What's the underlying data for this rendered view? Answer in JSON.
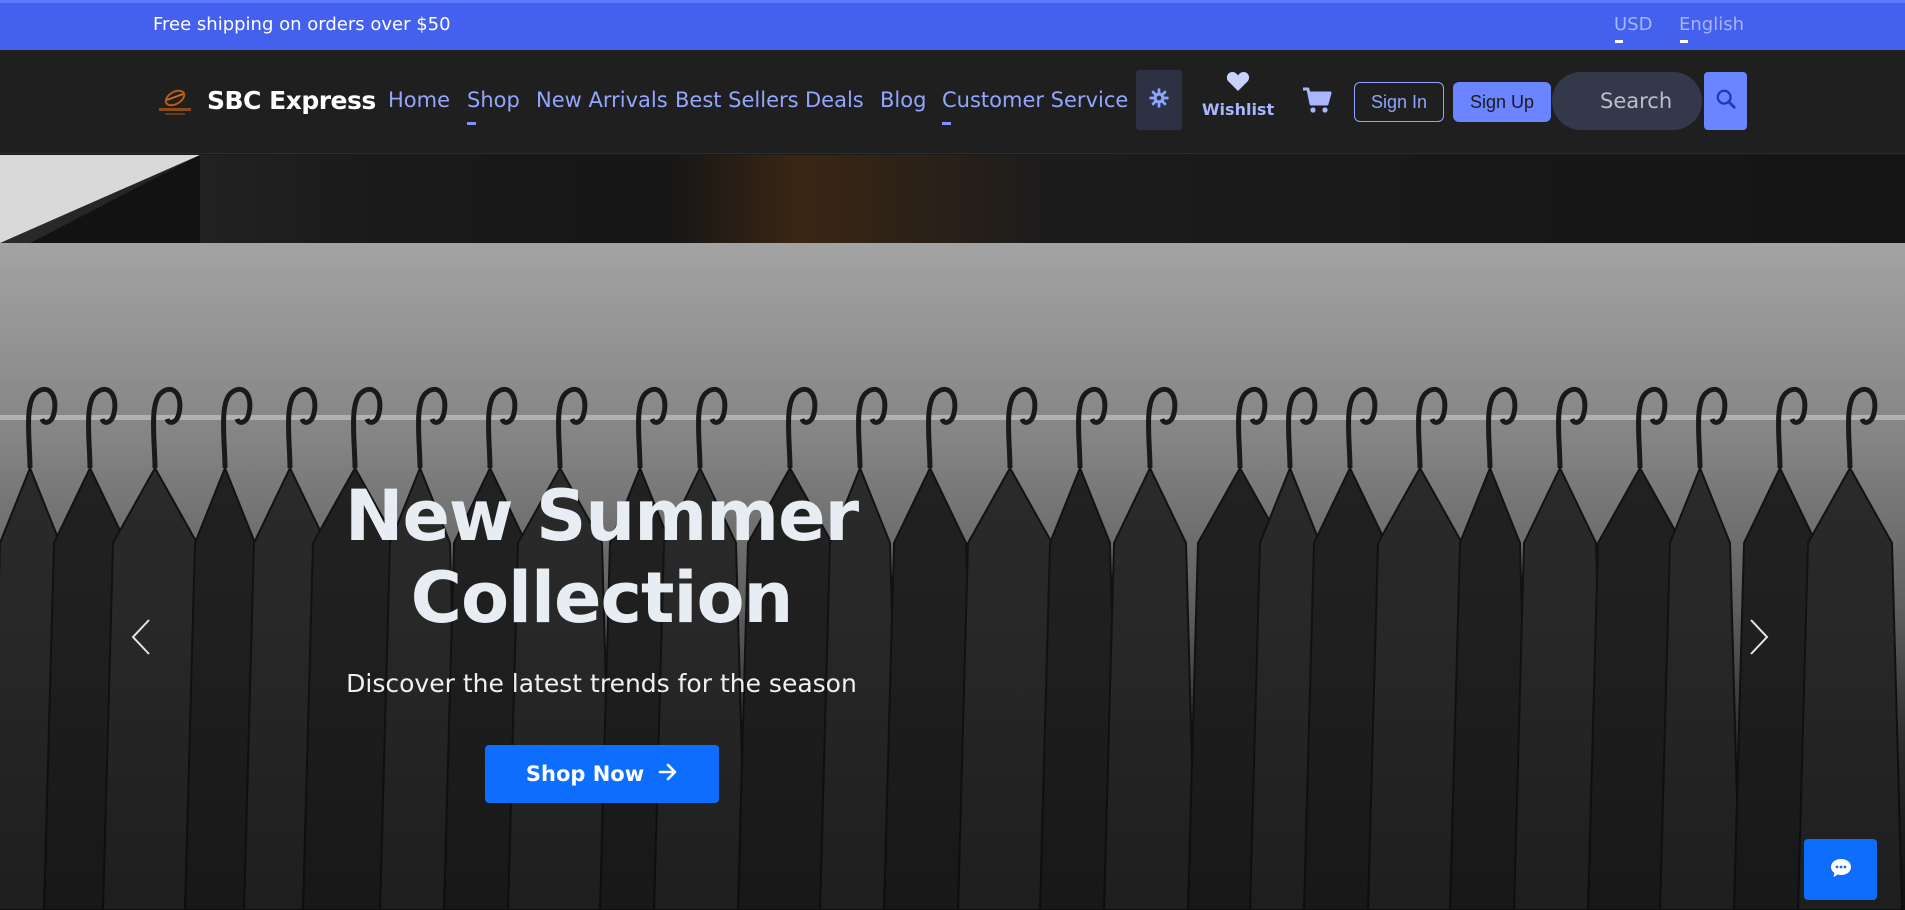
{
  "topbar": {
    "promo_text": "Free shipping on orders over $50",
    "currency": "USD",
    "language": "English"
  },
  "header": {
    "brand_name": "SBC Express",
    "nav": [
      {
        "label": "Home"
      },
      {
        "label": "Shop"
      },
      {
        "label": "New Arrivals"
      },
      {
        "label": "Best Sellers"
      },
      {
        "label": "Deals"
      },
      {
        "label": "Blog"
      },
      {
        "label": "Customer Service"
      }
    ],
    "wishlist_label": "Wishlist",
    "sign_in_label": "Sign In",
    "sign_up_label": "Sign Up",
    "search_placeholder": "Search"
  },
  "hero": {
    "title": "New Summer Collection",
    "subtitle": "Discover the latest trends for the season",
    "cta_label": "Shop Now"
  },
  "icons": {
    "theme_toggle": "gear-icon",
    "wishlist": "heart-icon",
    "cart": "cart-icon",
    "search": "search-icon",
    "carousel_prev": "chevron-left-icon",
    "carousel_next": "chevron-right-icon",
    "chat": "chat-icon",
    "cta_arrow": "arrow-right-icon"
  },
  "colors": {
    "topbar_bg": "#4361ee",
    "navbar_bg": "#1f1f1f",
    "accent": "#6a85ff",
    "cta_bg": "#0d6efd"
  }
}
